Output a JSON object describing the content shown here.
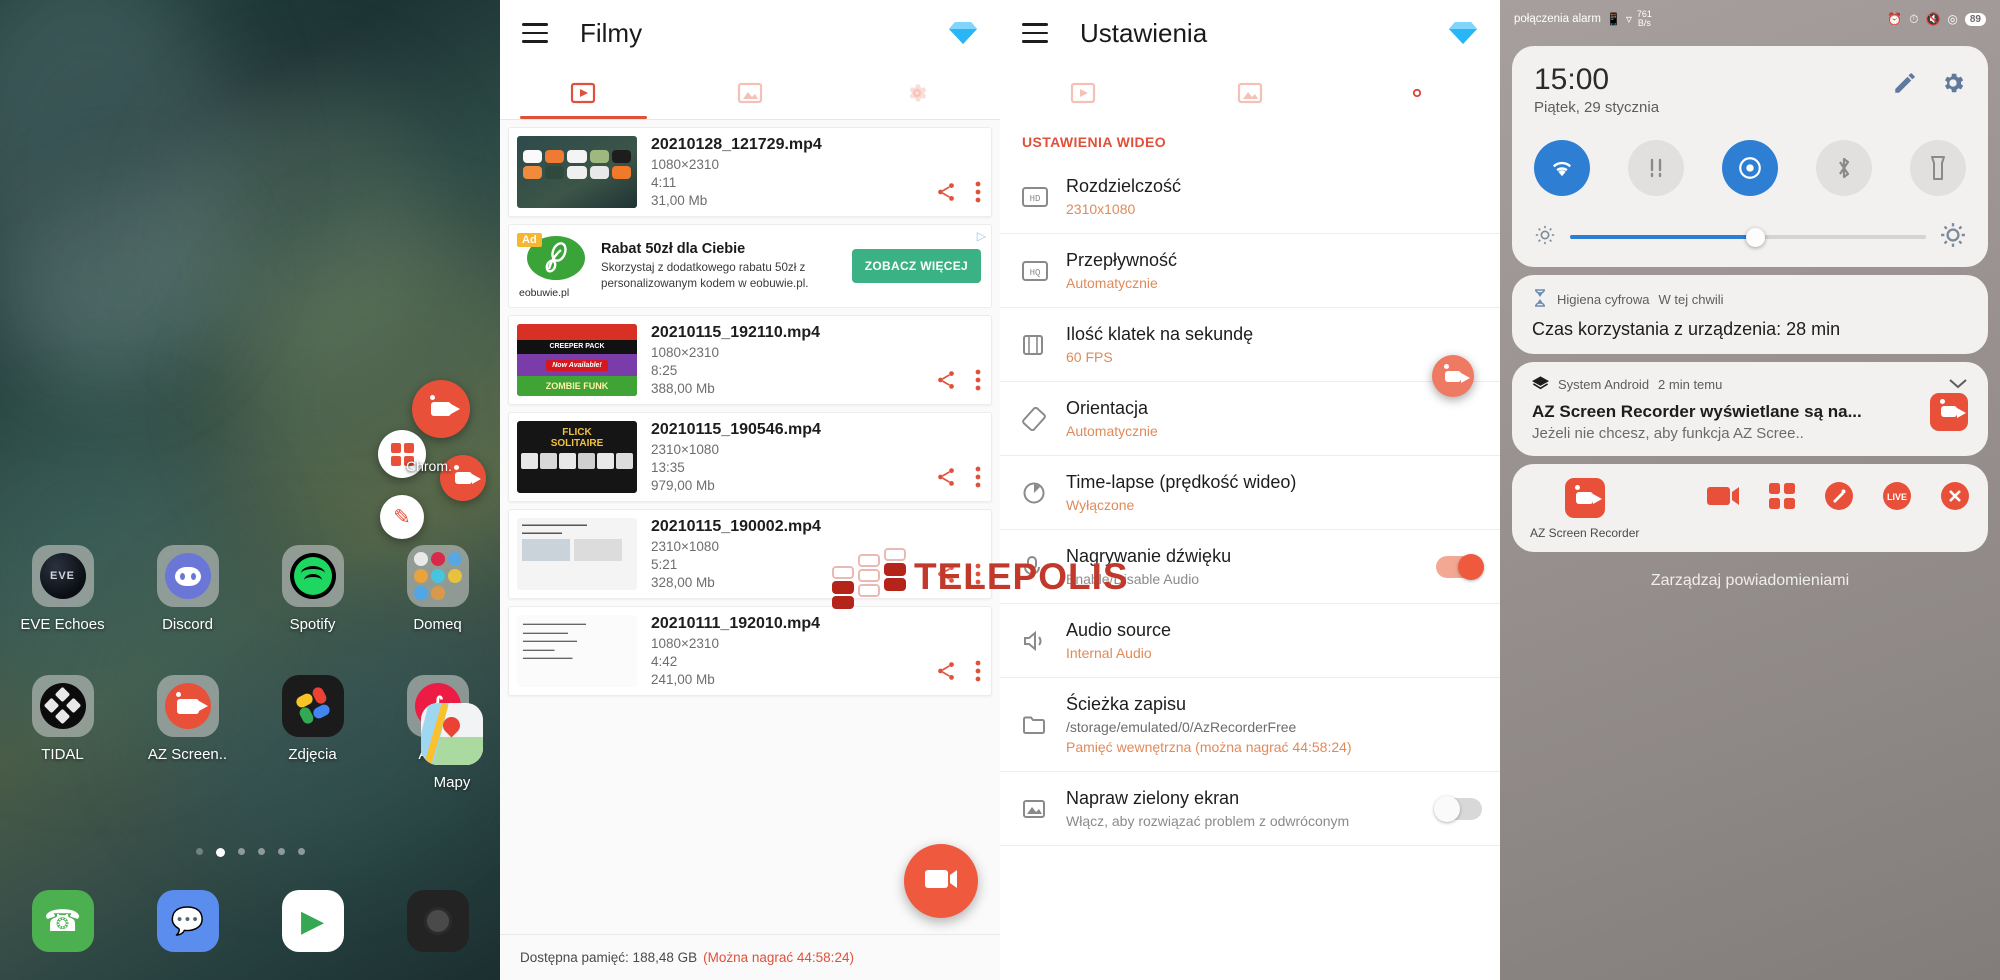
{
  "home": {
    "apps_row1": [
      {
        "label": "EVE Echoes",
        "icon": "eve-echoes-icon"
      },
      {
        "label": "Discord",
        "icon": "discord-icon"
      },
      {
        "label": "Spotify",
        "icon": "spotify-icon"
      },
      {
        "label": "Domeq",
        "icon": "folder-icon"
      }
    ],
    "apps_row2": [
      {
        "label": "TIDAL",
        "icon": "tidal-icon"
      },
      {
        "label": "AZ Screen..",
        "icon": "az-screen-recorder-icon"
      },
      {
        "label": "Zdjęcia",
        "icon": "google-photos-icon"
      },
      {
        "label": "Authy",
        "icon": "authy-icon"
      },
      {
        "label": "Mapy",
        "icon": "google-maps-icon"
      }
    ],
    "dock": [
      {
        "label": "phone",
        "icon": "phone-icon"
      },
      {
        "label": "messages",
        "icon": "messages-icon"
      },
      {
        "label": "play-store",
        "icon": "play-store-icon"
      },
      {
        "label": "camera",
        "icon": "camera-icon"
      }
    ],
    "page_dots": 6,
    "active_dot": 1,
    "floating": [
      {
        "name": "az-record-bubble",
        "icon": "video-camera-icon"
      },
      {
        "name": "az-grid-bubble",
        "icon": "grid-icon"
      },
      {
        "name": "az-brush-bubble",
        "icon": "brush-icon"
      },
      {
        "name": "az-rec-badge",
        "icon": "recorder-badge-icon"
      }
    ],
    "chrome_hint": "Chrom."
  },
  "filmy": {
    "title": "Filmy",
    "menu_icon": "hamburger-icon",
    "premium_icon": "diamond-icon",
    "tabs": [
      {
        "name": "videos",
        "icon": "play-rect-icon",
        "active": true
      },
      {
        "name": "images",
        "icon": "image-icon",
        "active": false
      },
      {
        "name": "settings",
        "icon": "gear-icon",
        "active": false
      }
    ],
    "videos": [
      {
        "name": "20210128_121729.mp4",
        "resolution": "1080×2310",
        "duration": "4:11",
        "size": "31,00 Mb",
        "thumb": "home-screen"
      },
      {
        "name": "20210115_192110.mp4",
        "resolution": "1080×2310",
        "duration": "8:25",
        "size": "388,00 Mb",
        "thumb": "creeper-pack"
      },
      {
        "name": "20210115_190546.mp4",
        "resolution": "2310×1080",
        "duration": "13:35",
        "size": "979,00 Mb",
        "thumb": "flick-solitaire"
      },
      {
        "name": "20210115_190002.mp4",
        "resolution": "2310×1080",
        "duration": "5:21",
        "size": "328,00 Mb",
        "thumb": "document"
      },
      {
        "name": "20210111_192010.mp4",
        "resolution": "1080×2310",
        "duration": "4:42",
        "size": "241,00 Mb",
        "thumb": "text-page"
      }
    ],
    "share_icon": "share-icon",
    "more_icon": "more-vertical-icon",
    "ad": {
      "badge": "Ad",
      "title": "Rabat 50zł dla Ciebie",
      "subtitle": "Skorzystaj z dodatkowego rabatu 50zł z personalizowanym kodem w eobuwie.pl.",
      "cta": "ZOBACZ WIĘCEJ",
      "brand": "eobuwie.pl",
      "choices_icon": "ad-choices-icon"
    },
    "storage_label": "Dostępna pamięć: 188,48 GB",
    "storage_record": "(Można nagrać 44:58:24)",
    "fab_icon": "record-video-icon"
  },
  "ustawienia": {
    "title": "Ustawienia",
    "menu_icon": "hamburger-icon",
    "premium_icon": "diamond-icon",
    "tabs": [
      {
        "name": "videos",
        "icon": "play-rect-icon",
        "active": false
      },
      {
        "name": "images",
        "icon": "image-icon",
        "active": false
      },
      {
        "name": "settings",
        "icon": "gear-icon",
        "active": true
      }
    ],
    "section_header": "USTAWIENIA WIDEO",
    "rows": [
      {
        "title": "Rozdzielczość",
        "value": "2310x1080",
        "icon": "hd-icon",
        "type": "value"
      },
      {
        "title": "Przepływność",
        "value": "Automatycznie",
        "icon": "hq-icon",
        "type": "value"
      },
      {
        "title": "Ilość klatek na sekundę",
        "value": "60 FPS",
        "icon": "film-icon",
        "type": "value"
      },
      {
        "title": "Orientacja",
        "value": "Automatycznie",
        "icon": "rotate-icon",
        "type": "value"
      },
      {
        "title": "Time-lapse (prędkość wideo)",
        "value": "Wyłączone",
        "icon": "timelapse-icon",
        "type": "value"
      },
      {
        "title": "Nagrywanie dźwięku",
        "value": "Enable/Disable Audio",
        "icon": "microphone-icon",
        "type": "toggle",
        "toggle": "on"
      },
      {
        "title": "Audio source",
        "value": "Internal Audio",
        "icon": "audio-source-icon",
        "type": "value"
      },
      {
        "title": "Ścieżka zapisu",
        "value": "/storage/emulated/0/AzRecorderFree",
        "value2": "Pamięć wewnętrzna (można nagrać 44:58:24)",
        "icon": "folder-icon",
        "type": "path"
      },
      {
        "title": "Napraw zielony ekran",
        "value": "Włącz, aby rozwiązać problem z odwróconym",
        "icon": "image-fix-icon",
        "type": "toggle",
        "toggle": "off"
      }
    ]
  },
  "shade": {
    "status": {
      "left_text": "połączenia alarm",
      "sim_icon": "sim-icon",
      "wifi_icon": "wifi-icon",
      "speed": "761",
      "speed_unit": "B/s",
      "right_icons": [
        "alarm-icon",
        "battery-saver-icon",
        "mute-icon",
        "location-icon"
      ],
      "battery": "89"
    },
    "time": "15:00",
    "date": "Piątek, 29 stycznia",
    "edit_icon": "pencil-icon",
    "settings_icon": "gear-icon",
    "quick_toggles": [
      {
        "name": "wifi",
        "icon": "wifi-icon",
        "state": "on"
      },
      {
        "name": "mobile-data",
        "icon": "signal-icon",
        "state": "off"
      },
      {
        "name": "location",
        "icon": "location-icon",
        "state": "on"
      },
      {
        "name": "bluetooth",
        "icon": "bluetooth-icon",
        "state": "off"
      },
      {
        "name": "flashlight",
        "icon": "flashlight-icon",
        "state": "off"
      }
    ],
    "brightness": {
      "low_icon": "brightness-low-icon",
      "high_icon": "brightness-high-icon",
      "value": 52
    },
    "digital_wellbeing": {
      "icon": "hourglass-icon",
      "app": "Higiena cyfrowa",
      "time": "W tej chwili",
      "body": "Czas korzystania z urządzenia: 28 min"
    },
    "notification": {
      "icon": "android-system-icon",
      "app": "System Android",
      "time": "2 min temu",
      "chevron": "chevron-down-icon",
      "title": "AZ Screen Recorder wyświetlane są na...",
      "body": "Jeżeli nie chcesz, aby funkcja AZ Scree..",
      "badge_icon": "az-recorder-icon"
    },
    "shortcuts": {
      "main": {
        "label": "AZ Screen Recorder",
        "icon": "az-recorder-icon"
      },
      "items": [
        {
          "name": "record",
          "icon": "video-camera-icon",
          "color": "#e8503a"
        },
        {
          "name": "screenshot-grid",
          "icon": "grid-icon",
          "color": "#e8503a"
        },
        {
          "name": "brush",
          "icon": "brush-icon",
          "color": "#e8503a"
        },
        {
          "name": "live",
          "icon": "live-icon",
          "color": "#e8503a"
        },
        {
          "name": "close",
          "icon": "close-icon",
          "color": "#e8503a"
        }
      ]
    },
    "manage": "Zarządzaj powiadomieniami"
  },
  "watermark": {
    "text": "TELEPOLIS"
  }
}
